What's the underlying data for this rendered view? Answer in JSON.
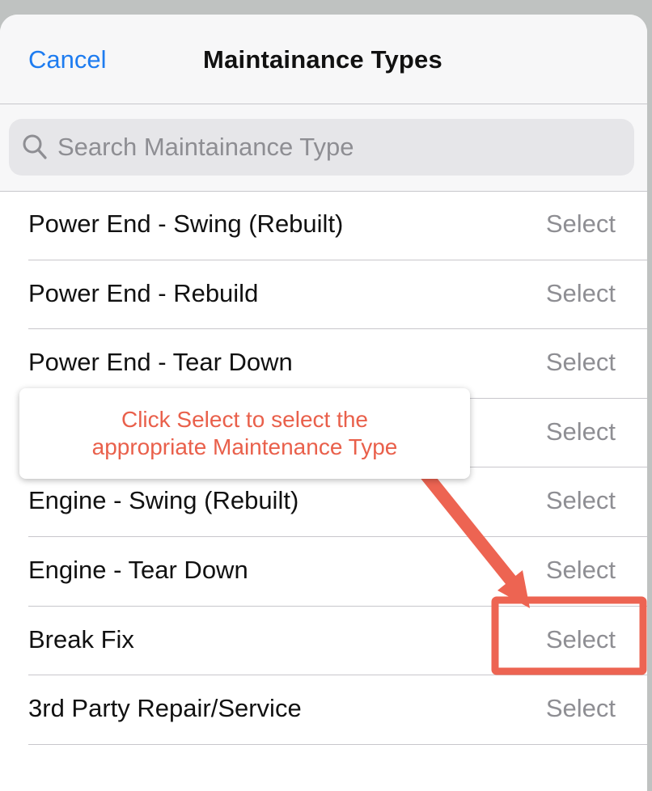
{
  "header": {
    "cancel_label": "Cancel",
    "title": "Maintainance Types"
  },
  "search": {
    "placeholder": "Search Maintainance Type",
    "value": ""
  },
  "items": [
    {
      "label": "Power End - Swing (Rebuilt)",
      "action": "Select"
    },
    {
      "label": "Power End - Rebuild",
      "action": "Select"
    },
    {
      "label": "Power End - Tear Down",
      "action": "Select"
    },
    {
      "label": "",
      "action": "Select"
    },
    {
      "label": "Engine - Swing (Rebuilt)",
      "action": "Select"
    },
    {
      "label": "Engine - Tear Down",
      "action": "Select"
    },
    {
      "label": "Break Fix",
      "action": "Select"
    },
    {
      "label": "3rd Party Repair/Service",
      "action": "Select"
    }
  ],
  "callout": {
    "line1": "Click Select to select the",
    "line2": "appropriate Maintenance Type"
  },
  "colors": {
    "accent": "#1e7cf0",
    "annotation": "#ed6452",
    "muted": "#8e8e93"
  }
}
